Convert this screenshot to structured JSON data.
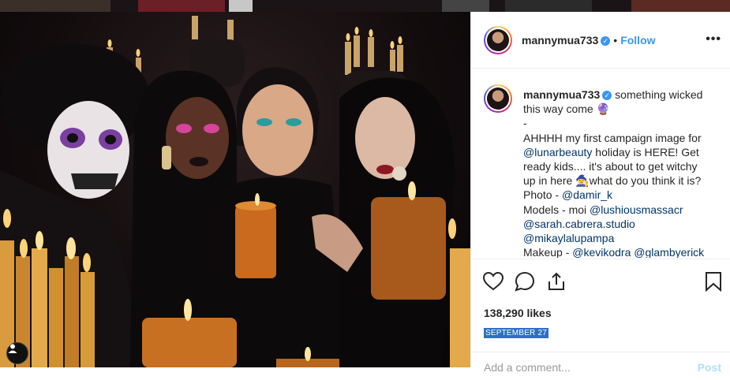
{
  "post": {
    "username": "mannymua733",
    "verified_mark": "✓",
    "dot": "•",
    "follow_label": "Follow",
    "more_label": "•••",
    "caption": {
      "username": "mannymua733",
      "line1": "something wicked this way come 🔮",
      "line2": "-",
      "line3": "AHHHH my first campaign image for ",
      "mention_luna": "@lunarbeauty",
      "line3b": " holiday is HERE! Get ready kids.... it's about to get witchy up in here 🧙‍♀️what do you think it is?",
      "photo_label": "Photo - ",
      "photo_mention": "@damir_k",
      "models_label": "Models - moi ",
      "models_mention1": "@lushiousmassacr",
      "models_mention2": "@sarah.cabrera.studio",
      "models_mention3": "@mikaylalupampa",
      "makeup_label": "Makeup - ",
      "makeup_mention1": "@kevikodra",
      "makeup_mention2": "@glambyerick"
    },
    "likes": "138,290 likes",
    "date": "SEPTEMBER 27",
    "comment_placeholder": "Add a comment...",
    "post_label": "Post"
  },
  "icons": {
    "like": "heart-icon",
    "comment": "comment-icon",
    "share": "share-icon",
    "save": "bookmark-icon",
    "more": "more-options-icon",
    "verified": "verified-badge-icon"
  },
  "colors": {
    "accent": "#3897f0",
    "mention": "#003569",
    "post_disabled": "#b2dffc"
  }
}
